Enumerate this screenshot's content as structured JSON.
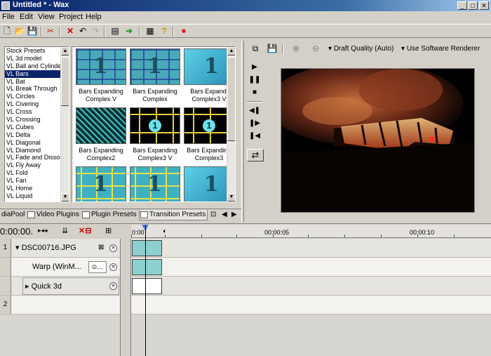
{
  "window": {
    "title": "Untitled * - Wax"
  },
  "menu": [
    "File",
    "Edit",
    "View",
    "Project",
    "Help"
  ],
  "presets": {
    "items": [
      "Stock Presets",
      "VL 3d model",
      "VL Ball and Cylinder",
      "VL Bars",
      "VL Bat",
      "VL Break Through",
      "VL Circles",
      "VL Civering",
      "VL Cross",
      "VL Crossing",
      "VL Cubes",
      "VL Delta",
      "VL Diagonal",
      "VL Diamond",
      "VL Fade and Dissolve",
      "VL Fly Away",
      "VL Fold",
      "VL Fan",
      "VL Home",
      "VL Liquid"
    ],
    "selected_index": 3
  },
  "thumbnails": [
    {
      "caption1": "Bars Expanding",
      "caption2": "Complex V",
      "style": "t-grid",
      "glyph": "1"
    },
    {
      "caption1": "Bars Expanding",
      "caption2": "Complex",
      "style": "t-grid",
      "glyph": "1"
    },
    {
      "caption1": "Bars Expandi",
      "caption2": "Complex3 V",
      "style": "t-cyan",
      "glyph": "1"
    },
    {
      "caption1": "Bars Expanding",
      "caption2": "Complex2",
      "style": "t-noise",
      "glyph": ""
    },
    {
      "caption1": "Bars Expanding",
      "caption2": "Complex3 V",
      "style": "t-black",
      "glyph": "1"
    },
    {
      "caption1": "Bars Expanding",
      "caption2": "Complex3",
      "style": "t-black",
      "glyph": "1"
    },
    {
      "caption1": "",
      "caption2": "",
      "style": "t-yellowgrid",
      "glyph": "1"
    },
    {
      "caption1": "",
      "caption2": "",
      "style": "t-yellowgrid",
      "glyph": "1"
    },
    {
      "caption1": "",
      "caption2": "",
      "style": "t-cyan",
      "glyph": "1"
    }
  ],
  "tabs": [
    "diaPool",
    "Video Plugins",
    "Plugin Presets",
    "Transition Presets"
  ],
  "preview": {
    "quality": "Draft Quality (Auto)",
    "renderer": "Use Software Renderer"
  },
  "timeline": {
    "timecode": "0:00:00.",
    "ruler": [
      "00:00:05",
      "00:00:10"
    ],
    "ruler_start": "0:00",
    "tracks": [
      {
        "number": "1",
        "name": "DSC00716.JPG"
      },
      {
        "number": "",
        "name": "Warp (WinM..."
      },
      {
        "number": "",
        "name": "Quick 3d"
      },
      {
        "number": "2",
        "name": ""
      }
    ]
  },
  "colors": {
    "titlebar": "#0a246a",
    "selection": "#0a246a",
    "clip": "#8ed0d0"
  }
}
